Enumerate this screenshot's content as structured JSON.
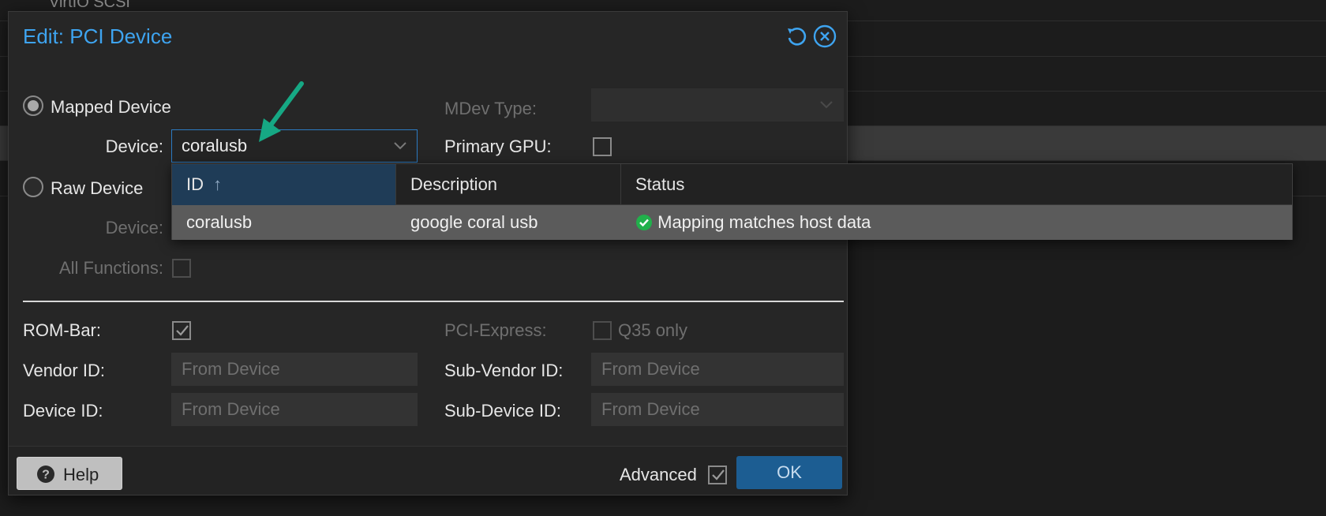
{
  "background": {
    "top_row_text": "VirtIO SCSI"
  },
  "dialog": {
    "title": "Edit: PCI Device",
    "header_icons": [
      "reset-icon",
      "close-icon"
    ],
    "mapped_device_label": "Mapped Device",
    "raw_device_label": "Raw Device",
    "device_label": "Device:",
    "device_value": "coralusb",
    "raw_device_label_dim": "Device:",
    "all_functions_label": "All Functions:",
    "mdev_type_label": "MDev Type:",
    "primary_gpu_label": "Primary GPU:",
    "rom_bar_label": "ROM-Bar:",
    "pci_express_label": "PCI-Express:",
    "q35_only_label": "Q35 only",
    "vendor_id_label": "Vendor ID:",
    "vendor_id_placeholder": "From Device",
    "sub_vendor_id_label": "Sub-Vendor ID:",
    "sub_vendor_id_placeholder": "From Device",
    "device_id_label": "Device ID:",
    "device_id_placeholder": "From Device",
    "sub_device_id_label": "Sub-Device ID:",
    "sub_device_id_placeholder": "From Device",
    "help_label": "Help",
    "advanced_label": "Advanced",
    "ok_label": "OK",
    "accent_color": "#3ea4f0"
  },
  "dropdown": {
    "columns": [
      "ID",
      "Description",
      "Status"
    ],
    "sort_indicator": "↑",
    "rows": [
      {
        "id": "coralusb",
        "description": "google coral usb",
        "status": "Mapping matches host data"
      }
    ],
    "status_ok_color": "#21b04b"
  },
  "annotation": {
    "arrow_color": "#16a884"
  }
}
